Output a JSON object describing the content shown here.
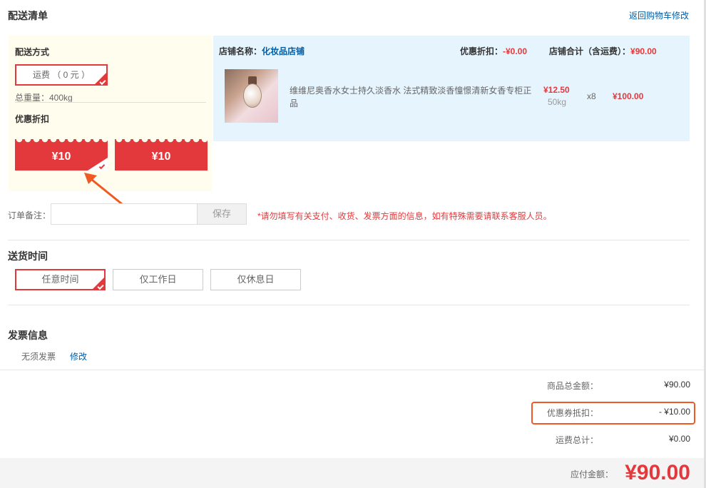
{
  "section_title": "配送清单",
  "back_link": "返回购物车修改",
  "shipping": {
    "method_label": "配送方式",
    "fee_button": "运费 （ 0 元 ）",
    "weight": "总重量：400kg",
    "discount_label": "优惠折扣",
    "coupons": [
      "¥10",
      "¥10"
    ]
  },
  "store": {
    "name_label": "店铺名称：",
    "name": "化妆品店铺",
    "discount_label": "优惠折扣：",
    "discount_value": "-¥0.00",
    "total_label": "店铺合计（含运费）：",
    "total_value": "¥90.00"
  },
  "product": {
    "title": "维维尼奥香水女士持久淡香水 法式精致淡香憧憬清新女香专柜正品",
    "price": "¥12.50",
    "weight": "50kg",
    "qty": "x8",
    "subtotal": "¥100.00"
  },
  "remark": {
    "label": "订单备注：",
    "value": "",
    "save": "保存",
    "notice": "*请勿填写有关支付、收货、发票方面的信息，如有特殊需要请联系客服人员。"
  },
  "delivery_time": {
    "title": "送货时间",
    "options": [
      "任意时间",
      "仅工作日",
      "仅休息日"
    ]
  },
  "invoice": {
    "title": "发票信息",
    "value": "无须发票",
    "edit": "修改"
  },
  "summary": {
    "goods_label": "商品总金额：",
    "goods_value": "¥90.00",
    "coupon_label": "优惠券抵扣：",
    "coupon_value": "- ¥10.00",
    "freight_label": "运费总计：",
    "freight_value": "¥0.00",
    "payable_label": "应付金额：",
    "payable_value": "¥90.00"
  },
  "colors": {
    "accent": "#e4393c",
    "link": "#005ea7",
    "highlight": "#f05a22"
  }
}
